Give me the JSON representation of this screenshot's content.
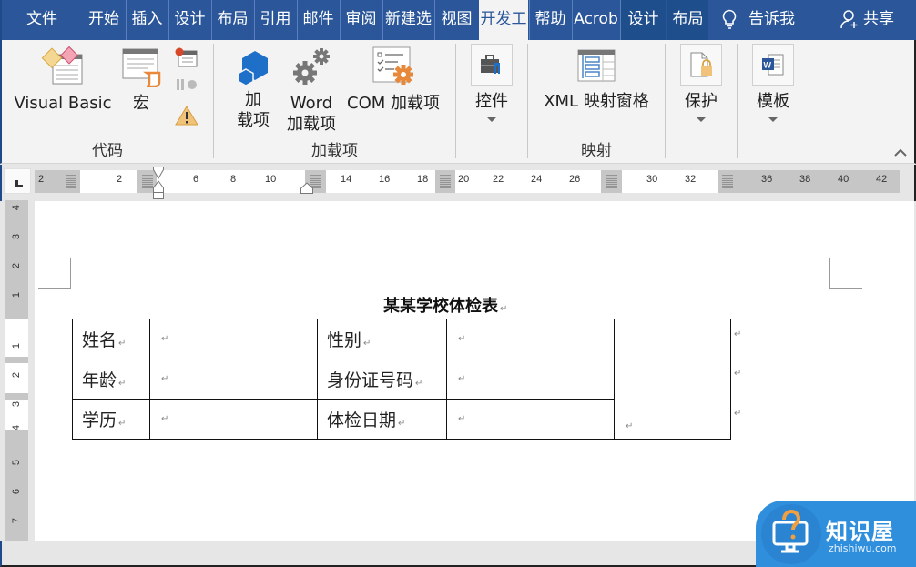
{
  "tabs": [
    {
      "label": "文件",
      "active": false
    },
    {
      "label": "开始",
      "active": false
    },
    {
      "label": "插入",
      "active": false
    },
    {
      "label": "设计",
      "active": false
    },
    {
      "label": "布局",
      "active": false
    },
    {
      "label": "引用",
      "active": false
    },
    {
      "label": "邮件",
      "active": false
    },
    {
      "label": "审阅",
      "active": false
    },
    {
      "label": "新建选",
      "active": false
    },
    {
      "label": "视图",
      "active": false
    },
    {
      "label": "开发工",
      "active": true
    },
    {
      "label": "帮助",
      "active": false
    },
    {
      "label": "Acrob",
      "active": false
    },
    {
      "label": "设计",
      "active": false,
      "contextual": true
    },
    {
      "label": "布局",
      "active": false,
      "contextual": true
    }
  ],
  "tell_me": {
    "label": "告诉我",
    "icon": "lightbulb-icon"
  },
  "share": {
    "label": "共享",
    "icon": "person-add-icon"
  },
  "ribbon": {
    "groups": [
      {
        "label": "代码",
        "buttons": [
          {
            "label": "Visual Basic",
            "icon": "visual-basic-icon"
          },
          {
            "label": "宏",
            "icon": "macros-icon"
          },
          {
            "label": "",
            "icon": "record-macro-icon"
          },
          {
            "label": "",
            "icon": "pause-recording-icon"
          },
          {
            "label": "",
            "icon": "macro-security-icon"
          }
        ]
      },
      {
        "label": "加载项",
        "buttons": [
          {
            "label_line1": "加",
            "label_line2": "载项",
            "icon": "add-ins-icon"
          },
          {
            "label_line1": "Word",
            "label_line2": "加载项",
            "icon": "word-add-ins-gears-icon"
          },
          {
            "label": "COM 加载项",
            "icon": "com-add-ins-icon"
          }
        ]
      },
      {
        "label": "",
        "buttons": [
          {
            "label": "控件",
            "icon": "controls-toolbox-icon",
            "dropdown": true
          }
        ]
      },
      {
        "label": "映射",
        "buttons": [
          {
            "label": "XML 映射窗格",
            "icon": "xml-mapping-pane-icon"
          }
        ]
      },
      {
        "label": "",
        "buttons": [
          {
            "label": "保护",
            "icon": "protect-document-icon",
            "dropdown": true
          }
        ]
      },
      {
        "label": "",
        "buttons": [
          {
            "label": "模板",
            "icon": "document-template-icon",
            "dropdown": true
          }
        ]
      }
    ]
  },
  "ruler": {
    "horizontal_numbers": [
      "2",
      "2",
      "6",
      "8",
      "10",
      "14",
      "16",
      "18",
      "20",
      "22",
      "24",
      "26",
      "30",
      "32",
      "36",
      "38",
      "40",
      "42"
    ],
    "vertical_numbers_top": [
      "4",
      "3",
      "2",
      "1"
    ],
    "vertical_numbers_page": [
      "1",
      "2",
      "3",
      "4",
      "5",
      "6",
      "7"
    ]
  },
  "document": {
    "title": "某某学校体检表",
    "paragraph_mark": "↵",
    "table": {
      "rows": [
        [
          "姓名",
          "",
          "性别",
          ""
        ],
        [
          "年龄",
          "",
          "身份证号码",
          ""
        ],
        [
          "学历",
          "",
          "体检日期",
          ""
        ]
      ],
      "photo_cell": ""
    }
  },
  "watermark": {
    "brand": "知识屋",
    "domain": "zhishiwu.com"
  },
  "colors": {
    "tab_bar": "#2b579a",
    "ribbon_bg": "#f3f3f3",
    "accent_orange": "#e8883a",
    "accent_blue": "#1e6fc7",
    "watermark_blue": "#2f8fdc"
  }
}
